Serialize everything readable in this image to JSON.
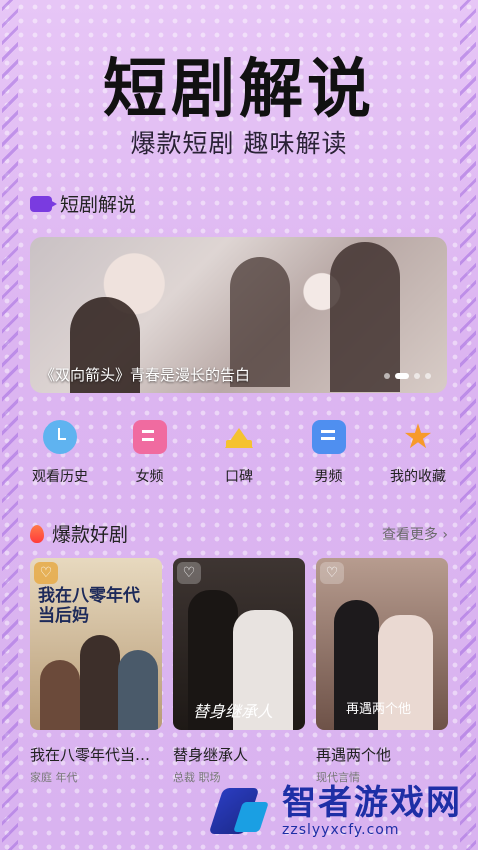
{
  "header": {
    "title": "短剧解说",
    "subtitle": "爆款短剧 趣味解读"
  },
  "section_explain": {
    "title": "短剧解说",
    "banner_caption": "《双向箭头》青春是漫长的告白"
  },
  "categories": [
    {
      "label": "观看历史",
      "icon": "clock-icon"
    },
    {
      "label": "女频",
      "icon": "female-channel-icon"
    },
    {
      "label": "口碑",
      "icon": "crown-icon"
    },
    {
      "label": "男频",
      "icon": "male-channel-icon"
    },
    {
      "label": "我的收藏",
      "icon": "star-icon"
    }
  ],
  "section_hot": {
    "title": "爆款好剧",
    "more": "查看更多"
  },
  "dramas": [
    {
      "name": "我在八零年代当…",
      "tags": "家庭 年代",
      "poster_text": "我在八零年代当后妈"
    },
    {
      "name": "替身继承人",
      "tags": "总裁 职场",
      "poster_text": "替身继承人"
    },
    {
      "name": "再遇两个他",
      "tags": "现代言情",
      "poster_text": "再遇两个他"
    }
  ],
  "watermark": {
    "brand": "智者游戏网",
    "url": "zzslyyxcfy.com"
  }
}
